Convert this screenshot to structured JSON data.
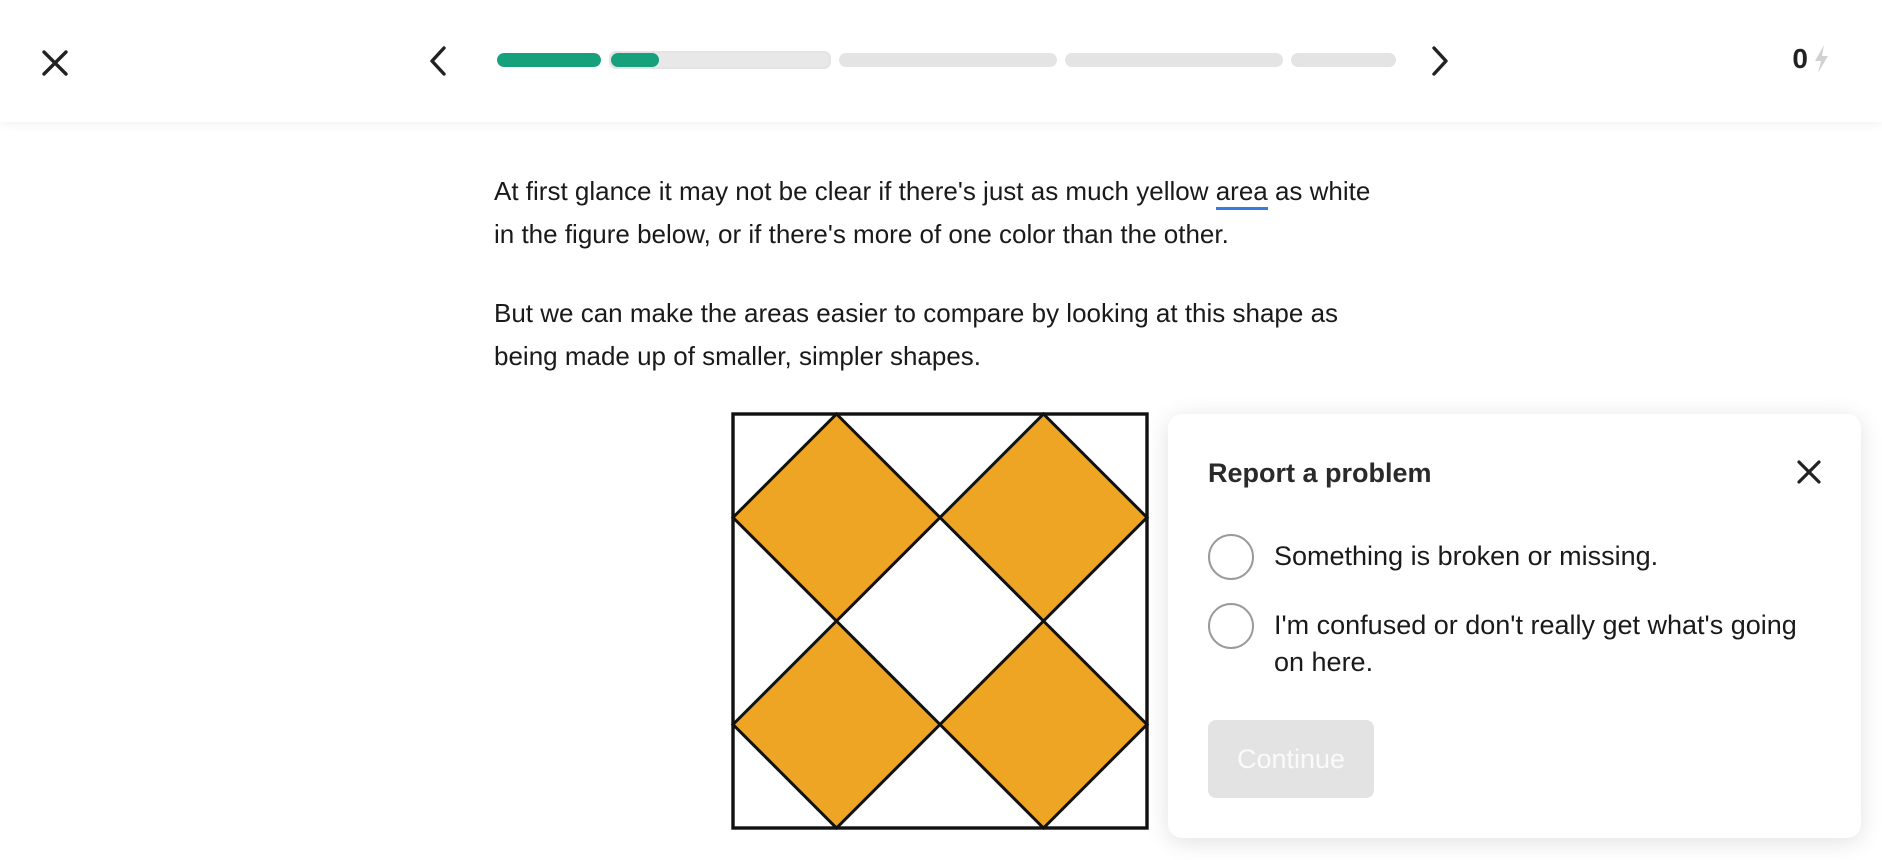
{
  "header": {
    "close_icon": "close-icon",
    "prev_icon": "chevron-left-icon",
    "next_icon": "chevron-right-icon",
    "progress": {
      "segments": [
        {
          "fill": 1.0,
          "current": false
        },
        {
          "fill": 0.22,
          "current": true
        },
        {
          "fill": 0.0,
          "current": false
        },
        {
          "fill": 0.0,
          "current": false
        },
        {
          "fill": 0.0,
          "current": false
        }
      ],
      "accent_color": "#16a07c"
    },
    "score": "0",
    "score_icon": "lightning-icon"
  },
  "lesson": {
    "p1_before": "At first glance it may not be clear if there's just as much yellow ",
    "p1_link": "area",
    "p1_after": " as white in the figure below, or if there's more of one color than the other.",
    "p2": "But we can make the areas easier to compare by looking at this shape as being made up of smaller, simpler shapes.",
    "figure": {
      "fill_color": "#eda523",
      "stroke_color": "#111111",
      "diamond_count": 4
    }
  },
  "report_panel": {
    "title": "Report a problem",
    "close_icon": "close-icon",
    "options": [
      {
        "label": "Something is broken or missing."
      },
      {
        "label": "I'm confused or don't really get what's going on here."
      }
    ],
    "continue_label": "Continue",
    "continue_enabled": false
  }
}
